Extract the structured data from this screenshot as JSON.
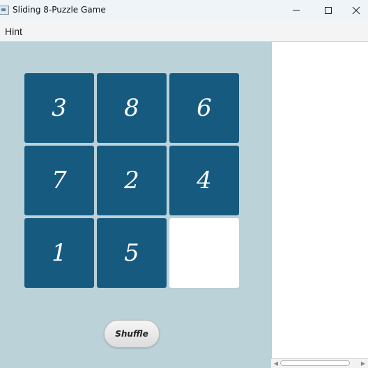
{
  "window": {
    "title": "Sliding 8-Puzzle Game"
  },
  "menu": {
    "hint_label": "Hint"
  },
  "puzzle": {
    "tiles": [
      "3",
      "8",
      "6",
      "7",
      "2",
      "4",
      "1",
      "5",
      ""
    ],
    "tile_color": "#175a80",
    "empty_color": "#ffffff",
    "board_background": "#bbd2d9"
  },
  "controls": {
    "shuffle_label": "Shuffle"
  }
}
